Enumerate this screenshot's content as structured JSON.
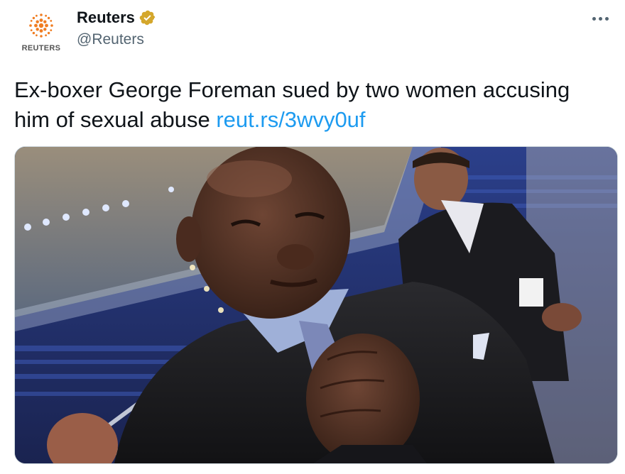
{
  "account": {
    "display_name": "Reuters",
    "handle": "@Reuters",
    "avatar_word": "REUTERS",
    "verified": true,
    "verified_badge_color": "#d4a72c",
    "logo_color": "#f07d22"
  },
  "tweet": {
    "text": "Ex-boxer George Foreman sued by two women accusing him of sexual abuse",
    "link": "reut.rs/3wvy0uf",
    "link_color": "#1d9bf0"
  },
  "media": {
    "type": "photo"
  },
  "icons": {
    "more": "more-horizontal-icon",
    "verified": "verified-badge-icon",
    "logo": "reuters-dot-logo-icon"
  }
}
